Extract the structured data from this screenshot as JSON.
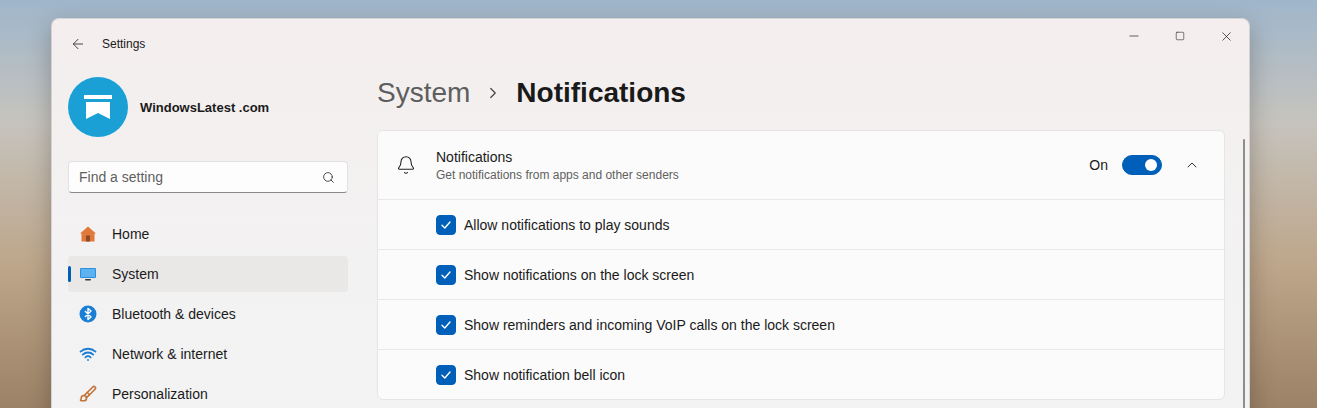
{
  "window": {
    "title": "Settings"
  },
  "account": {
    "name": "WindowsLatest .com"
  },
  "search": {
    "placeholder": "Find a setting"
  },
  "sidebar": {
    "items": [
      {
        "label": "Home",
        "selected": false
      },
      {
        "label": "System",
        "selected": true
      },
      {
        "label": "Bluetooth & devices",
        "selected": false
      },
      {
        "label": "Network & internet",
        "selected": false
      },
      {
        "label": "Personalization",
        "selected": false
      }
    ]
  },
  "breadcrumb": {
    "parent": "System",
    "current": "Notifications"
  },
  "notifications": {
    "title": "Notifications",
    "description": "Get notifications from apps and other senders",
    "state_label": "On",
    "on": true,
    "expanded": true,
    "options": [
      {
        "label": "Allow notifications to play sounds",
        "checked": true
      },
      {
        "label": "Show notifications on the lock screen",
        "checked": true
      },
      {
        "label": "Show reminders and incoming VoIP calls on the lock screen",
        "checked": true
      },
      {
        "label": "Show notification bell icon",
        "checked": true
      }
    ]
  }
}
